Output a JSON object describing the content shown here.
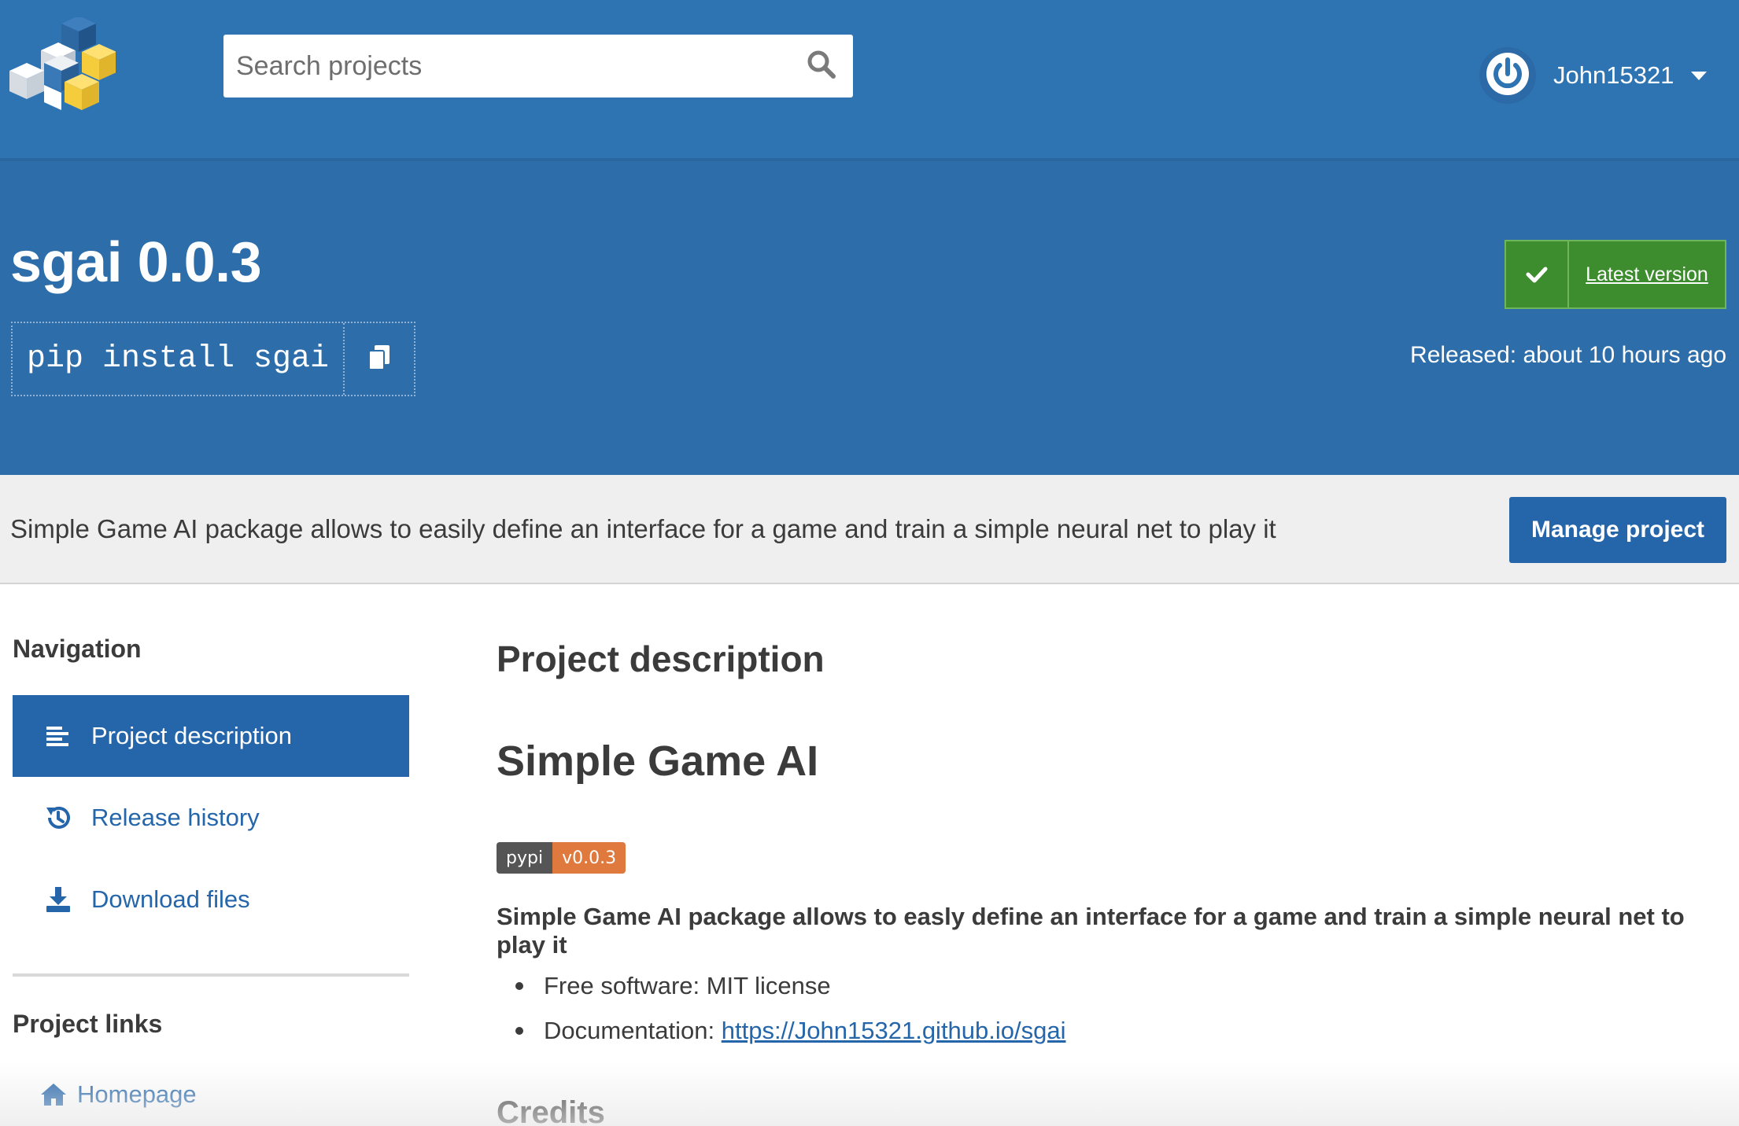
{
  "header": {
    "search_placeholder": "Search projects",
    "username": "John15321"
  },
  "banner": {
    "title": "sgai 0.0.3",
    "pip_command": "pip install sgai",
    "latest_label": "Latest version",
    "released": "Released: about 10 hours ago"
  },
  "summary": {
    "text": "Simple Game AI package allows to easily define an interface for a game and train a simple neural net to play it",
    "manage_label": "Manage project"
  },
  "sidebar": {
    "nav_heading": "Navigation",
    "nav": [
      {
        "label": "Project description",
        "icon": "align-left-icon"
      },
      {
        "label": "Release history",
        "icon": "history-icon"
      },
      {
        "label": "Download files",
        "icon": "download-icon"
      }
    ],
    "links_heading": "Project links",
    "links": [
      {
        "label": "Homepage",
        "icon": "home-icon"
      }
    ]
  },
  "main": {
    "section_title": "Project description",
    "readme_title": "Simple Game AI",
    "badge": {
      "left": "pypi",
      "right": "v0.0.3"
    },
    "lead": "Simple Game AI package allows to easly define an interface for a game and train a simple neural net to play it",
    "bullets": [
      {
        "label": "Free software: MIT license"
      },
      {
        "label": "Documentation: ",
        "link": "https://John15321.github.io/sgai"
      }
    ],
    "credits_title": "Credits"
  },
  "colors": {
    "header_blue": "#2e73b2",
    "banner_blue": "#2d6da9",
    "link_blue": "#2566ab",
    "latest_green": "#3d8c2e",
    "badge_orange": "#e0793d"
  }
}
